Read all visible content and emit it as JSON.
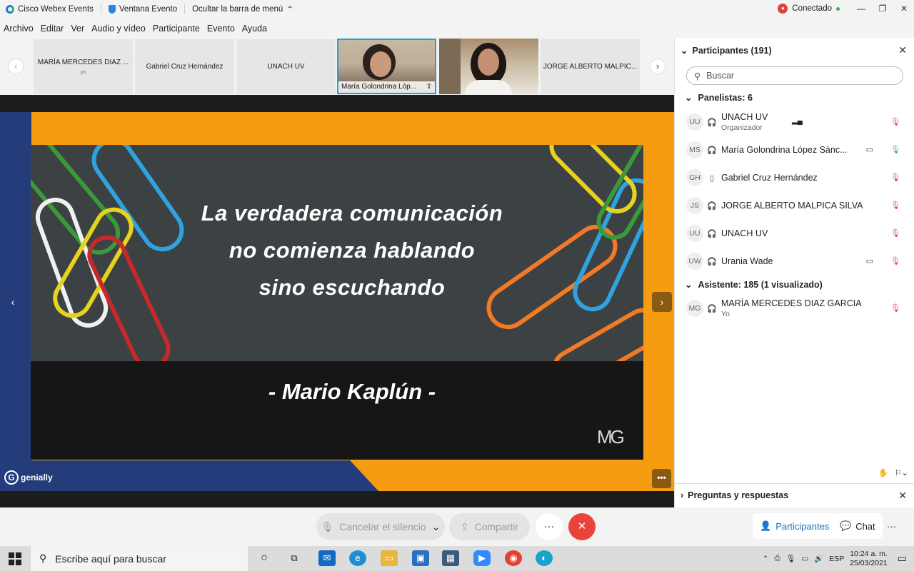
{
  "titlebar": {
    "app_name": "Cisco Webex Events",
    "window_label": "Ventana Evento",
    "hide_menu": "Ocultar la barra de menú",
    "status": "Conectado"
  },
  "menu": [
    "Archivo",
    "Editar",
    "Ver",
    "Audio y vídeo",
    "Participante",
    "Evento",
    "Ayuda"
  ],
  "strip": {
    "tiles": [
      {
        "name": "MARÍA MERCEDES DIAZ ...",
        "sub": "yo"
      },
      {
        "name": "Gabriel Cruz Hernández",
        "sub": ""
      },
      {
        "name": "UNACH UV",
        "sub": ""
      }
    ],
    "active_video_label": "María Golondrina Lóp...",
    "last_tile": "JORGE ALBERTO MALPIC..."
  },
  "slide": {
    "quote_lines": [
      "La verdadera comunicación",
      "no comienza hablando",
      "sino escuchando"
    ],
    "author": "- Mario Kaplún -",
    "logo_text": "MG",
    "brand": "genially",
    "more_label": "•••"
  },
  "controls": {
    "mute_label": "Cancelar el silencio",
    "share_label": "Compartir",
    "more_label": "···",
    "participants_label": "Participantes",
    "chat_label": "Chat",
    "more_label_right": "···"
  },
  "panel": {
    "title": "Participantes (191)",
    "search_placeholder": "Buscar",
    "panelists_header": "Panelistas: 6",
    "attendees_header": "Asistente: 185 (1 visualizado)",
    "panelists": [
      {
        "initials": "UU",
        "name": "UNACH UV",
        "sub": "Organizador",
        "camera": false
      },
      {
        "initials": "MS",
        "name": "María Golondrina López Sánc...",
        "sub": "",
        "camera": true
      },
      {
        "initials": "GH",
        "name": "Gabriel Cruz Hernández",
        "sub": "",
        "camera": false
      },
      {
        "initials": "JS",
        "name": "JORGE ALBERTO MALPICA SILVA",
        "sub": "",
        "camera": false
      },
      {
        "initials": "UU",
        "name": "UNACH UV",
        "sub": "",
        "camera": false
      },
      {
        "initials": "UW",
        "name": "Urania Wade",
        "sub": "",
        "camera": true
      }
    ],
    "attendees": [
      {
        "initials": "MG",
        "name": "MARÍA MERCEDES DIAZ GARCIA",
        "sub": "Yo"
      }
    ],
    "qa_title": "Preguntas y respuestas"
  },
  "taskbar": {
    "search_placeholder": "Escribe aquí para buscar",
    "lang": "ESP",
    "time": "10:24 a. m.",
    "date": "25/03/2021"
  },
  "colors": {
    "accent_blue": "#1b7fcf",
    "slide_orange": "#f59c10",
    "slide_navy": "#243d7a",
    "end_red": "#e8443a",
    "mic_red": "#e2473f"
  }
}
